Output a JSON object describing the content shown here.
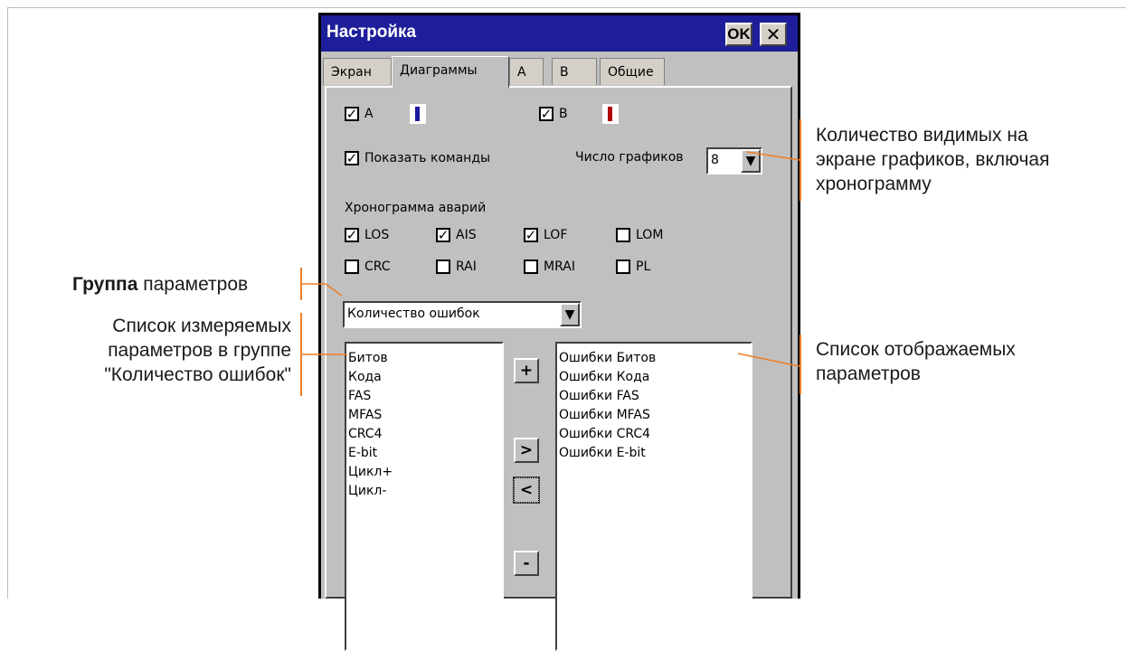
{
  "dialog": {
    "title": "Настройка",
    "ok_label": "OK",
    "close_label": "✕",
    "tabs": [
      {
        "label": "Экран"
      },
      {
        "label": "Диаграммы"
      },
      {
        "label": "A"
      },
      {
        "label": "B"
      },
      {
        "label": "Общие"
      }
    ],
    "active_tab": "Диаграммы",
    "channel_a": {
      "label": "A",
      "checked": true,
      "color": "#1a1aa0"
    },
    "channel_b": {
      "label": "B",
      "checked": true,
      "color": "#b00000"
    },
    "show_commands": {
      "label": "Показать команды",
      "checked": true
    },
    "graph_count": {
      "label": "Число графиков",
      "value": "8"
    },
    "alarm_section_label": "Хронограмма аварий",
    "alarms": [
      {
        "label": "LOS",
        "checked": true
      },
      {
        "label": "AIS",
        "checked": true
      },
      {
        "label": "LOF",
        "checked": true
      },
      {
        "label": "LOM",
        "checked": false
      },
      {
        "label": "CRC",
        "checked": false
      },
      {
        "label": "RAI",
        "checked": false
      },
      {
        "label": "MRAI",
        "checked": false
      },
      {
        "label": "PL",
        "checked": false
      }
    ],
    "group_select": {
      "value": "Количество ошибок"
    },
    "available_params": [
      "Битов",
      "Кода",
      "FAS",
      "MFAS",
      "CRC4",
      "E-bit",
      "Цикл+",
      "Цикл-"
    ],
    "displayed_params": [
      "Ошибки Битов",
      "Ошибки Кода",
      "Ошибки FAS",
      "Ошибки MFAS",
      "Ошибки CRC4",
      "Ошибки E-bit"
    ],
    "buttons": {
      "add": "+",
      "move_right": ">",
      "move_left": "<",
      "remove": "-"
    }
  },
  "annotations": {
    "group_bold": "Группа",
    "group_rest": " параметров",
    "param_list": [
      "Список измеряемых",
      "параметров в группе",
      "\"Количество ошибок\""
    ],
    "graph_count": [
      "Количество видимых на",
      "экране графиков, включая",
      "хронограмму"
    ],
    "display_list": [
      "Список отображаемых",
      "параметров"
    ],
    "accent_color": "#f07e26"
  }
}
